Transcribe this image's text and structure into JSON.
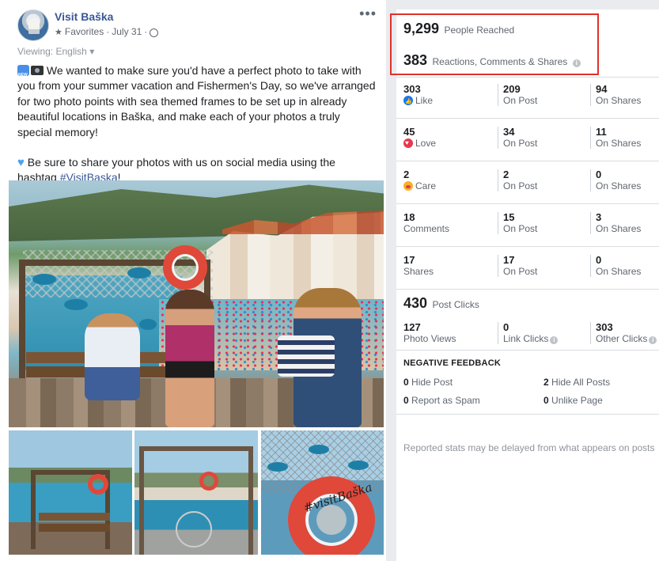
{
  "post": {
    "page_name": "Visit Baška",
    "audience": "Favorites",
    "date": "July 31",
    "separator": "·",
    "viewing_label": "Viewing: English",
    "text_p1": "We wanted to make sure you'd have a perfect photo to take with you from your summer vacation and Fishermen's Day, so we've arranged for two photo points with sea themed frames to be set up in already beautiful locations in Baška, and make each of your photos a truly special memory!",
    "text_p2_prefix": "Be sure to share your photos with us on social media using the hashtag",
    "hashtag": "#VisitBaska",
    "text_p2_suffix": "!",
    "photo_text": "#visitBaška",
    "icons": {
      "more": "more-options-icon",
      "audience": "star-icon",
      "privacy": "globe-icon",
      "emoji_new": "new-badge-emoji",
      "emoji_camera": "camera-emoji",
      "emoji_heart": "blue-heart-emoji"
    }
  },
  "insights": {
    "people_reached": {
      "value": "9,299",
      "label": "People Reached"
    },
    "engagements": {
      "value": "383",
      "label": "Reactions, Comments & Shares"
    },
    "rows": [
      {
        "name": "like",
        "total": "303",
        "label": "Like",
        "icon": "like-reaction-icon",
        "on_post": "209",
        "on_post_label": "On Post",
        "on_shares": "94",
        "on_shares_label": "On Shares"
      },
      {
        "name": "love",
        "total": "45",
        "label": "Love",
        "icon": "love-reaction-icon",
        "on_post": "34",
        "on_post_label": "On Post",
        "on_shares": "11",
        "on_shares_label": "On Shares"
      },
      {
        "name": "care",
        "total": "2",
        "label": "Care",
        "icon": "care-reaction-icon",
        "on_post": "2",
        "on_post_label": "On Post",
        "on_shares": "0",
        "on_shares_label": "On Shares"
      },
      {
        "name": "comments",
        "total": "18",
        "label": "Comments",
        "on_post": "15",
        "on_post_label": "On Post",
        "on_shares": "3",
        "on_shares_label": "On Shares"
      },
      {
        "name": "shares",
        "total": "17",
        "label": "Shares",
        "on_post": "17",
        "on_post_label": "On Post",
        "on_shares": "0",
        "on_shares_label": "On Shares"
      }
    ],
    "post_clicks": {
      "value": "430",
      "label": "Post Clicks"
    },
    "clicks": [
      {
        "value": "127",
        "label": "Photo Views"
      },
      {
        "value": "0",
        "label": "Link Clicks"
      },
      {
        "value": "303",
        "label": "Other Clicks"
      }
    ],
    "negative_feedback": {
      "title": "NEGATIVE FEEDBACK",
      "hide_post": {
        "value": "0",
        "label": "Hide Post"
      },
      "hide_all": {
        "value": "2",
        "label": "Hide All Posts"
      },
      "spam": {
        "value": "0",
        "label": "Report as Spam"
      },
      "unlike": {
        "value": "0",
        "label": "Unlike Page"
      }
    },
    "disclaimer": "Reported stats may be delayed from what appears on posts",
    "colors": {
      "highlight": "#e0312b",
      "link": "#385898",
      "like": "#1877f2",
      "love": "#e8384f",
      "care": "#f7b125"
    }
  }
}
